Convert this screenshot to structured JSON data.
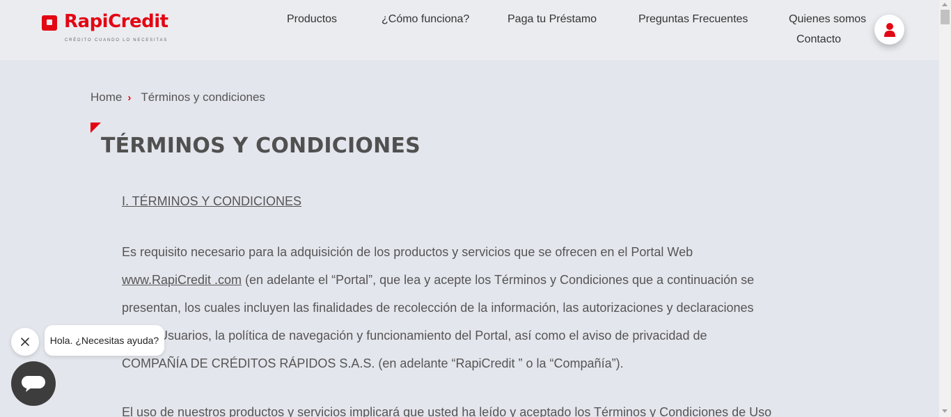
{
  "header": {
    "logo_text": "RapiCredit",
    "logo_tagline": "CRÉDITO CUANDO LO NECESITAS",
    "nav": {
      "productos": "Productos",
      "como_funciona": "¿Cómo funciona?",
      "paga": "Paga tu Préstamo",
      "preguntas": "Preguntas Frecuentes",
      "quienes": "Quienes somos",
      "contacto": "Contacto"
    },
    "user_icon": "user-icon"
  },
  "breadcrumb": {
    "home": "Home",
    "separator": "›",
    "current": "Términos y condiciones"
  },
  "page_title": "TÉRMINOS Y CONDICIONES",
  "section_title": "I. TÉRMINOS Y CONDICIONES",
  "paragraph1": {
    "before_link": "Es requisito necesario para la adquisición de los productos y servicios que se ofrecen en el Portal Web ",
    "link": "www.RapiCredit .com",
    "after_link": " (en adelante el “Portal”, que lea y acepte los Términos y Condiciones que a continuación se presentan, los cuales incluyen las finalidades de recolección de la información, las autorizaciones y declaraciones de los Usuarios, la política de navegación y funcionamiento del Portal, así como el aviso de privacidad de COMPAÑÍA DE CRÉDITOS RÁPIDOS S.A.S. (en adelante “RapiCredit ” o la “Compañía”)."
  },
  "paragraph2": "El uso de nuestros productos y servicios implicará que usted ha leído y aceptado los Términos y Condiciones de Uso",
  "chat": {
    "greeting": "Hola. ¿Necesitas ayuda?",
    "close_icon": "close-icon",
    "chat_icon": "chat-icon"
  },
  "colors": {
    "brand": "#e30613",
    "background": "#e4e6ed",
    "header": "#ebecf0",
    "chat_button": "#3d3d3d"
  }
}
